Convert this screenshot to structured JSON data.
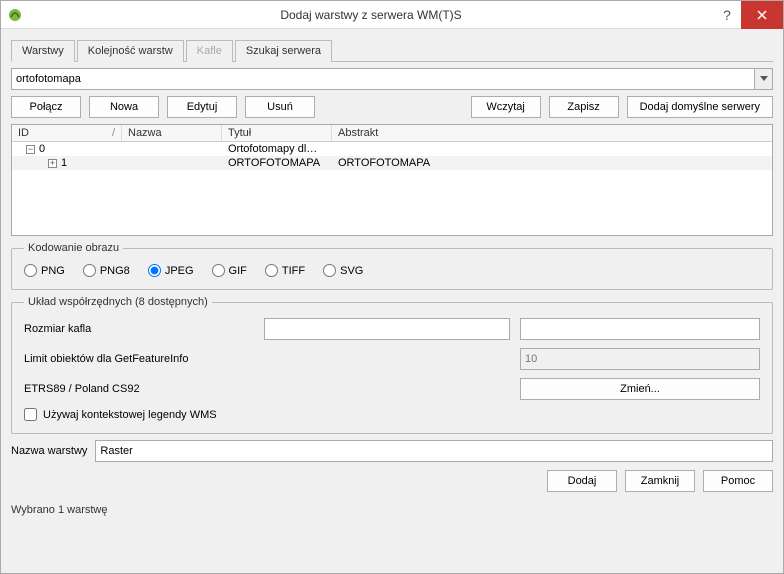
{
  "window": {
    "title": "Dodaj warstwy z serwera WM(T)S"
  },
  "tabs": [
    "Warstwy",
    "Kolejność warstw",
    "Kafle",
    "Szukaj serwera"
  ],
  "connection": {
    "value": "ortofotomapa"
  },
  "buttons": {
    "connect": "Połącz",
    "new_": "Nowa",
    "edit": "Edytuj",
    "delete_": "Usuń",
    "load": "Wczytaj",
    "save": "Zapisz",
    "add_default": "Dodaj domyślne serwery"
  },
  "table": {
    "headers": [
      "ID",
      "Nazwa",
      "Tytuł",
      "Abstrakt"
    ],
    "rows": [
      {
        "id": "0",
        "name": "",
        "title": "Ortofotomapy dl…",
        "abstract": ""
      },
      {
        "id": "1",
        "name": "",
        "title": "ORTOFOTOMAPA",
        "abstract": "ORTOFOTOMAPA"
      }
    ]
  },
  "image_encoding": {
    "legend": "Kodowanie obrazu",
    "options": [
      "PNG",
      "PNG8",
      "JPEG",
      "GIF",
      "TIFF",
      "SVG"
    ],
    "selected": "JPEG"
  },
  "crs": {
    "legend": "Układ współrzędnych (8 dostępnych)",
    "tile_size_label": "Rozmiar kafla",
    "feature_limit_label": "Limit obiektów dla GetFeatureInfo",
    "feature_limit_value": "10",
    "current": "ETRS89 / Poland CS92",
    "change_button": "Zmień...",
    "contextual_legend": "Używaj kontekstowej legendy WMS"
  },
  "layer_name": {
    "label": "Nazwa warstwy",
    "value": "Raster"
  },
  "footer": {
    "add": "Dodaj",
    "close": "Zamknij",
    "help": "Pomoc"
  },
  "status": "Wybrano 1 warstwę"
}
